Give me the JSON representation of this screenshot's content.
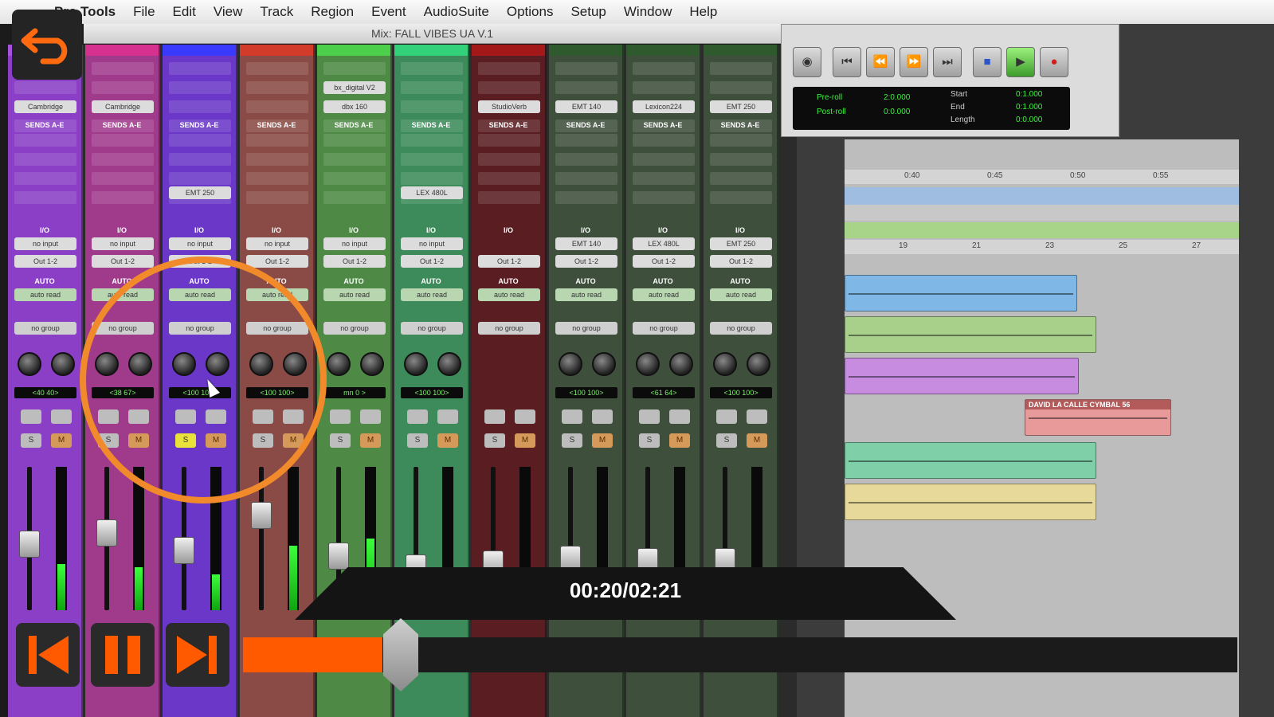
{
  "app_menu": {
    "items": [
      "Pro Tools",
      "File",
      "Edit",
      "View",
      "Track",
      "Region",
      "Event",
      "AudioSuite",
      "Options",
      "Setup",
      "Window",
      "Help"
    ]
  },
  "mix_window": {
    "title": "Mix: FALL VIBES UA V.1",
    "strips": [
      {
        "color": "#8a3fc6",
        "top": "#a552e0",
        "insert": "Cambridge",
        "send": "",
        "input": "no input",
        "output": "Out 1-2",
        "auto": "auto read",
        "group": "no group",
        "pan": "<40  40>",
        "solo": "S",
        "mute": "M",
        "fader": 0.45,
        "meter": 0.32
      },
      {
        "color": "#a03b8c",
        "top": "#d6318e",
        "insert": "Cambridge",
        "send": "",
        "input": "no input",
        "output": "Out 1-2",
        "auto": "auto read",
        "group": "no group",
        "pan": "<38  67>",
        "solo": "S",
        "mute": "M",
        "fader": 0.55,
        "meter": 0.3
      },
      {
        "color": "#6a37c9",
        "top": "#3a3aff",
        "insert": "",
        "send": "EMT 250",
        "input": "no input",
        "output": "Out 1-2",
        "auto": "auto read",
        "group": "no group",
        "pan": "<100 100>",
        "solo": "S",
        "mute": "M",
        "fader": 0.4,
        "meter": 0.25,
        "solo_on": true
      },
      {
        "color": "#8a4a45",
        "top": "#d23a2a",
        "insert": "",
        "send": "",
        "input": "no input",
        "output": "Out 1-2",
        "auto": "auto read",
        "group": "no group",
        "pan": "<100 100>",
        "solo": "S",
        "mute": "M",
        "fader": 0.7,
        "meter": 0.45
      },
      {
        "color": "#4e8a45",
        "top": "#4cd04c",
        "insert": "bx_digital V2",
        "insert2": "dbx 160",
        "send": "",
        "input": "no input",
        "output": "Out 1-2",
        "auto": "auto read",
        "group": "no group",
        "pan": "mn  0  >",
        "solo": "S",
        "mute": "M",
        "fader": 0.35,
        "meter": 0.5
      },
      {
        "color": "#3d8a5a",
        "top": "#33d27a",
        "insert": "",
        "send": "LEX 480L",
        "input": "no input",
        "output": "Out 1-2",
        "auto": "auto read",
        "group": "no group",
        "pan": "<100 100>",
        "solo": "S",
        "mute": "M",
        "fader": 0.25,
        "meter": 0.2
      },
      {
        "color": "#5a1e22",
        "top": "#a31818",
        "insert": "StudioVerb",
        "send": "",
        "input": "",
        "output": "Out 1-2",
        "auto": "auto read",
        "group": "no group",
        "pan": "",
        "solo": "S",
        "mute": "M",
        "fader": 0.28,
        "meter": 0.18
      },
      {
        "color": "#3e4f3c",
        "top": "#2e5a2e",
        "insert": "EMT 140",
        "send": "",
        "input": "EMT 140",
        "output": "Out 1-2",
        "auto": "auto read",
        "group": "no group",
        "pan": "<100 100>",
        "solo": "S",
        "mute": "M",
        "fader": 0.32,
        "meter": 0.28
      },
      {
        "color": "#3e4f3c",
        "top": "#2e5a2e",
        "insert": "Lexicon224",
        "send": "",
        "input": "LEX 480L",
        "output": "Out 1-2",
        "auto": "auto read",
        "group": "no group",
        "pan": "<61  64>",
        "solo": "S",
        "mute": "M",
        "fader": 0.3,
        "meter": 0.25
      },
      {
        "color": "#3e4f3c",
        "top": "#2e5a2e",
        "insert": "EMT 250",
        "send": "",
        "input": "EMT 250",
        "output": "Out 1-2",
        "auto": "auto read",
        "group": "no group",
        "pan": "<100 100>",
        "solo": "S",
        "mute": "M",
        "fader": 0.3,
        "meter": 0.22
      }
    ],
    "sends_label": "SENDS A-E",
    "io_label": "I/O",
    "auto_label": "AUTO"
  },
  "transport": {
    "pre_roll": "Pre-roll",
    "post_roll": "Post-roll",
    "pre_val": "2:0.000",
    "post_val": "0:0.000",
    "start_label": "Start",
    "end_label": "End",
    "length_label": "Length",
    "start_val": "0:1.000",
    "end_val": "0:1.000",
    "length_val": "0:0.000"
  },
  "edit_window": {
    "ruler_ticks": [
      "0:40",
      "0:45",
      "0:50",
      "0:55"
    ],
    "bar_ticks": [
      "19",
      "21",
      "23",
      "25",
      "27"
    ],
    "clips": [
      {
        "name": "",
        "color": "#7fb8e6",
        "row": 0
      },
      {
        "name": "",
        "color": "#a9d08a",
        "row": 1
      },
      {
        "name": "",
        "color": "#c78ce0",
        "row": 2
      },
      {
        "name": "DAVID LA CALLE CYMBAL 56",
        "color": "#e89a9a",
        "row": 3
      },
      {
        "name": "",
        "color": "#7fd0a8",
        "row": 4
      },
      {
        "name": "",
        "color": "#e6d99a",
        "row": 5
      }
    ]
  },
  "player": {
    "timecode": "00:20/02:21",
    "progress": 0.14,
    "back_icon": "undo-arrow-icon",
    "prev_icon": "skip-previous-icon",
    "pause_icon": "pause-icon",
    "next_icon": "skip-next-icon",
    "accent": "#ff5a00"
  }
}
